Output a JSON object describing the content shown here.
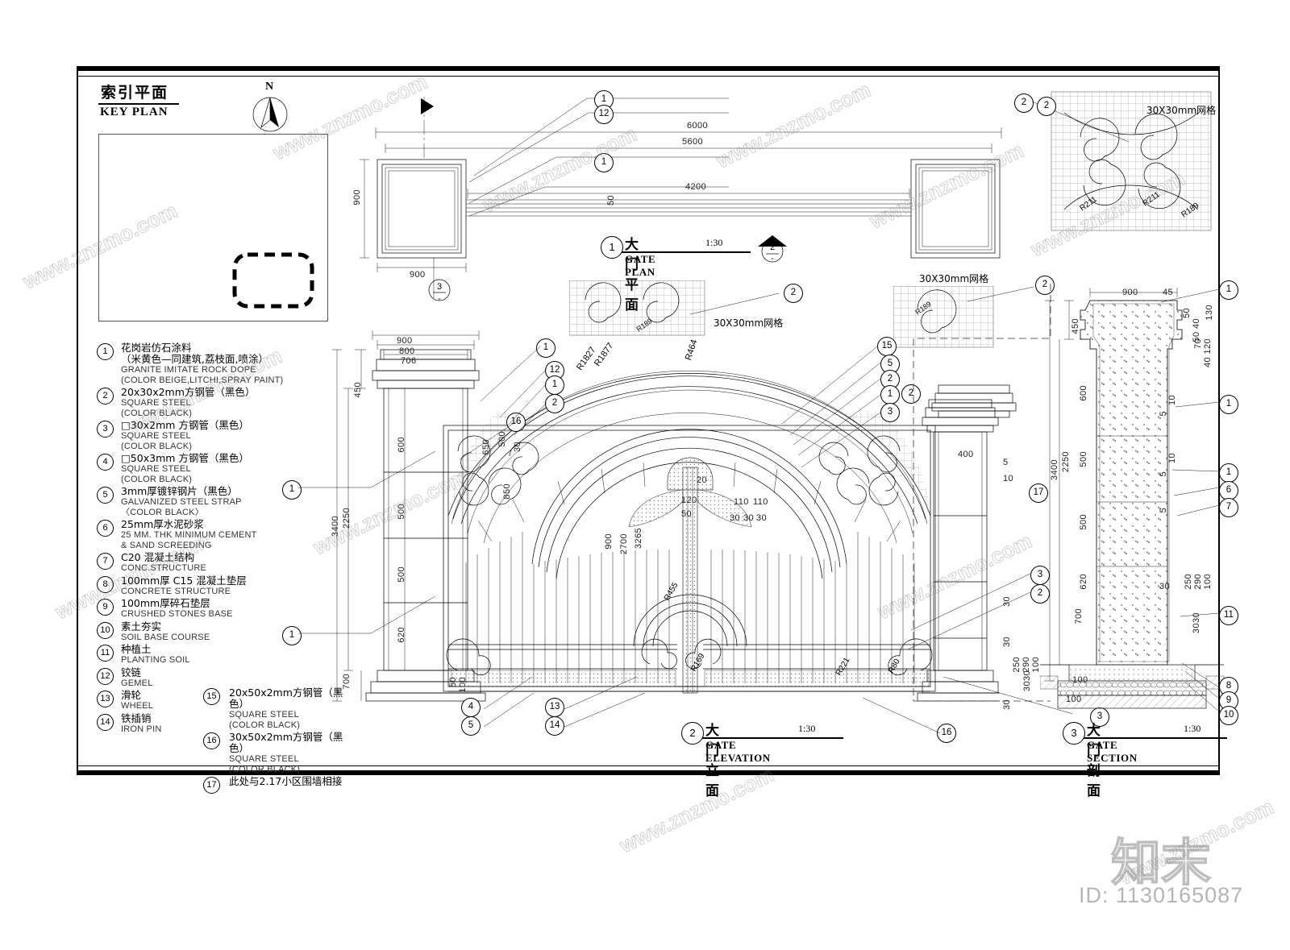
{
  "sheet": {
    "key_plan": {
      "title_cn": "索引平面",
      "title_en": "KEY PLAN",
      "north_label": "N"
    },
    "watermark": {
      "site": "www.znzmo.com",
      "brand_cn": "知末",
      "id_text": "ID: 1130165087"
    }
  },
  "legend": {
    "items": [
      {
        "num": "1",
        "cn": "花岗岩仿石涂料",
        "cn2": "（米黄色—同建筑,荔枝面,喷涂）",
        "en": "GRANITE IMITATE ROCK DOPE",
        "en2": "(COLOR BEIGE,LITCHI,SPRAY PAINT)"
      },
      {
        "num": "2",
        "cn": "20x30x2mm方钢管（黑色）",
        "en": "SQUARE STEEL",
        "en2": "(COLOR BLACK)"
      },
      {
        "num": "3",
        "cn": "□30x2mm 方钢管（黑色）",
        "en": "SQUARE STEEL",
        "en2": "(COLOR BLACK)"
      },
      {
        "num": "4",
        "cn": "□50x3mm 方钢管（黑色）",
        "en": "SQUARE STEEL",
        "en2": "(COLOR BLACK)"
      },
      {
        "num": "5",
        "cn": "3mm厚镀锌钢片（黑色）",
        "en": "GALVANIZED STEEL STRAP",
        "en2": "〈COLOR BLACK〉"
      },
      {
        "num": "6",
        "cn": "25mm厚水泥砂浆",
        "en": "25 MM. THK MINIMUM CEMENT",
        "en2": "& SAND SCREEDING"
      },
      {
        "num": "7",
        "cn": "C20 混凝土结构",
        "en": "CONC.STRUCTURE",
        "en2": ""
      },
      {
        "num": "8",
        "cn": "100mm厚 C15 混凝土垫层",
        "en": "CONCRETE STRUCTURE",
        "en2": ""
      },
      {
        "num": "9",
        "cn": "100mm厚碎石垫层",
        "en": "CRUSHED STONES BASE",
        "en2": ""
      },
      {
        "num": "10",
        "cn": "素土夯实",
        "en": "SOIL BASE COURSE",
        "en2": ""
      },
      {
        "num": "11",
        "cn": "种植土",
        "en": "PLANTING SOIL",
        "en2": ""
      },
      {
        "num": "12",
        "cn": "铰链",
        "en": "GEMEL",
        "en2": ""
      },
      {
        "num": "13",
        "cn": "滑轮",
        "en": "WHEEL",
        "en2": ""
      },
      {
        "num": "14",
        "cn": "铁插销",
        "en": "IRON PIN",
        "en2": ""
      }
    ],
    "items_right": [
      {
        "num": "15",
        "cn": "20x50x2mm方钢管（黑色）",
        "en": "SQUARE STEEL",
        "en2": "(COLOR BLACK)"
      },
      {
        "num": "16",
        "cn": "30x50x2mm方钢管（黑色）",
        "en": "SQUARE STEEL",
        "en2": "(COLOR BLACK)"
      },
      {
        "num": "17",
        "cn": "此处与2.17小区围墙相接",
        "en": "",
        "en2": ""
      }
    ]
  },
  "titles": [
    {
      "num": "1",
      "cn": "大门平面",
      "en": "GATE PLAN",
      "scale": "1:30"
    },
    {
      "num": "2",
      "cn": "大门立面",
      "en": "GATE ELEVATION",
      "scale": "1:30"
    },
    {
      "num": "3",
      "cn": "大门剖面",
      "en": "GATE SECTION",
      "scale": "1:30"
    }
  ],
  "notes": {
    "mesh_label": "30X30mm网格",
    "mesh_label_2": "30X30mm网格",
    "mesh_label_3": "30X30mm网格"
  },
  "plan_dims": {
    "overall": "6000",
    "inner": "5600",
    "opening": "4200",
    "pier_w": "900",
    "pier_h": "900",
    "leaf_gap": "50"
  },
  "elevation_dims": {
    "cap_w": "900",
    "cap_w2": "800",
    "shaft_w": "706",
    "cap_h": "450",
    "seg1": "600",
    "seg2": "500",
    "seg3": "500",
    "seg4": "620",
    "total": "3400",
    "pier_h": "2250",
    "base": "700",
    "base2": "50",
    "base3": "100",
    "arch_h": "2700",
    "leaf_h": "900",
    "rail_h": "850",
    "span": "3265",
    "r_outer": "R1827",
    "r_mid": "R1877",
    "r_center": "R464",
    "r_small": "R455",
    "r_189": "R189",
    "r_169": "R169",
    "r_221": "R221",
    "r_80": "R80",
    "t20": "20",
    "t120": "120",
    "t50": "50",
    "t110a": "110",
    "t110b": "110",
    "t30a": "30",
    "t30b": "30",
    "t30c": "30",
    "t650": "650",
    "t500": "500",
    "t30d": "30"
  },
  "section_dims": {
    "cap_w": "900",
    "d45": "45",
    "d50": "50",
    "d130": "130",
    "d5040": "50 40",
    "d40120": "40 120",
    "d70": "70",
    "cap_h": "450",
    "seg1": "600",
    "seg2": "500",
    "seg3": "500",
    "seg4": "620",
    "pier_h": "2250",
    "total": "3400",
    "base": "700",
    "d10": "10",
    "d5": "5",
    "d250": "250",
    "d290": "290",
    "d100": "100",
    "d3030": "3030",
    "d30": "30",
    "d400": "400",
    "d17": "17"
  },
  "callouts": {
    "plan": [
      "1",
      "12",
      "1",
      "2"
    ],
    "elevation_left": [
      "1",
      "12",
      "1",
      "2",
      "16",
      "1",
      "1"
    ],
    "elevation_right": [
      "15",
      "5",
      "2",
      "1",
      "3",
      "3",
      "2",
      "3",
      "16"
    ],
    "elevation_bottom": [
      "4",
      "5",
      "13",
      "14",
      "3",
      "16"
    ],
    "section_right": [
      "1",
      "1",
      "1",
      "6",
      "7",
      "5",
      "8",
      "9",
      "10",
      "11"
    ],
    "section_left": [
      "2",
      "2",
      "3",
      "17",
      "3",
      "2"
    ]
  }
}
